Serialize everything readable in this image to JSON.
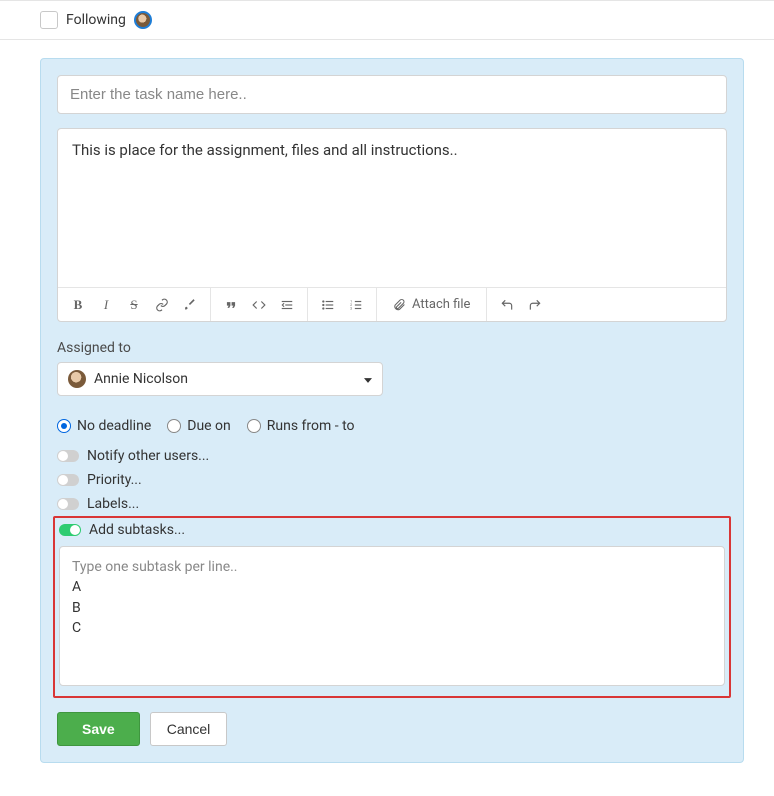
{
  "header": {
    "following_label": "Following"
  },
  "task": {
    "name_placeholder": "Enter the task name here..",
    "description_placeholder": "This is place for the assignment, files and all instructions.."
  },
  "toolbar": {
    "attach_label": "Attach file"
  },
  "assigned": {
    "label": "Assigned to",
    "value": "Annie Nicolson"
  },
  "deadline": {
    "options": [
      {
        "label": "No deadline",
        "selected": true
      },
      {
        "label": "Due on",
        "selected": false
      },
      {
        "label": "Runs from - to",
        "selected": false
      }
    ]
  },
  "toggles": {
    "notify": {
      "label": "Notify other users...",
      "on": false
    },
    "priority": {
      "label": "Priority...",
      "on": false
    },
    "labels": {
      "label": "Labels...",
      "on": false
    },
    "subtasks": {
      "label": "Add subtasks...",
      "on": true
    }
  },
  "subtasks": {
    "placeholder_line": "Type one subtask per line..",
    "lines": [
      "A",
      "B",
      "C"
    ]
  },
  "buttons": {
    "save": "Save",
    "cancel": "Cancel"
  }
}
